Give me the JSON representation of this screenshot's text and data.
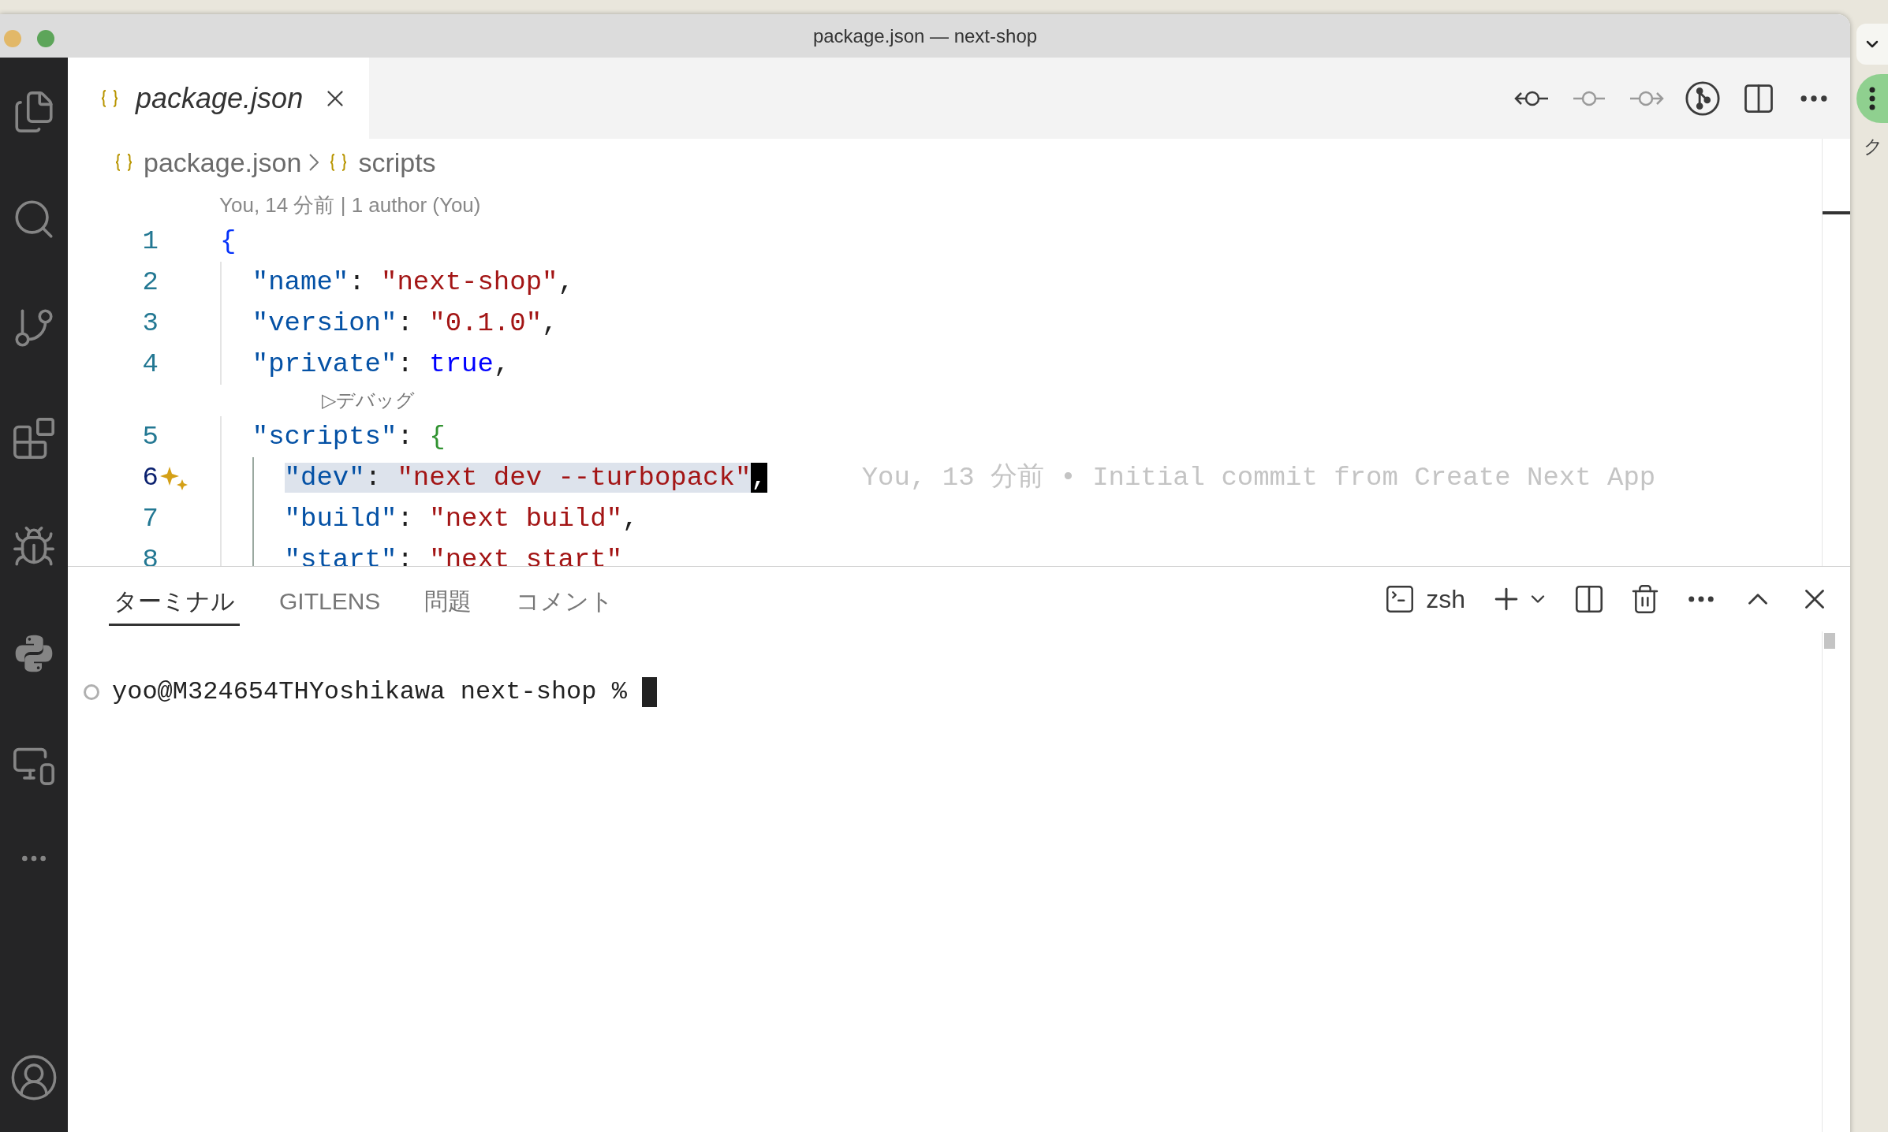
{
  "window": {
    "title": "package.json — next-shop"
  },
  "editor_tabs": [
    {
      "label": "package.json",
      "selected": true,
      "preview": true
    }
  ],
  "breadcrumb": [
    "package.json",
    "scripts"
  ],
  "codelens": "You, 14 分前 | 1 author (You)",
  "lines": [
    {
      "number": "1",
      "current": false,
      "tokens": [
        {
          "kind": "brace1",
          "text": "{"
        }
      ],
      "children": [
        {
          "number": "2",
          "current": false,
          "tokens": [
            {
              "kind": "key",
              "text": "\"name\""
            },
            {
              "kind": "punct",
              "text": ": "
            },
            {
              "kind": "string",
              "text": "\"next-shop\""
            },
            {
              "kind": "punct",
              "text": ","
            }
          ]
        },
        {
          "number": "3",
          "current": false,
          "tokens": [
            {
              "kind": "key",
              "text": "\"version\""
            },
            {
              "kind": "punct",
              "text": ": "
            },
            {
              "kind": "string",
              "text": "\"0.1.0\""
            },
            {
              "kind": "punct",
              "text": ","
            }
          ]
        },
        {
          "number": "4",
          "current": false,
          "tokens": [
            {
              "kind": "key",
              "text": "\"private\""
            },
            {
              "kind": "punct",
              "text": ": "
            },
            {
              "kind": "bool",
              "text": "true"
            },
            {
              "kind": "punct",
              "text": ","
            }
          ]
        },
        {
          "number": "5",
          "current": false,
          "lens": "▷デバッグ",
          "tokens": [
            {
              "kind": "key",
              "text": "\"scripts\""
            },
            {
              "kind": "punct",
              "text": ": "
            },
            {
              "kind": "brace2",
              "text": "{"
            }
          ],
          "children": [
            {
              "number": "6",
              "current": true,
              "blame": "You, 13 分前 • Initial commit from Create Next App",
              "tokens": [
                {
                  "kind": "key",
                  "text": "\"dev\"",
                  "selected": true
                },
                {
                  "kind": "punct",
                  "text": ": ",
                  "selected": true
                },
                {
                  "kind": "string",
                  "text": "\"next dev --turbopack\"",
                  "selected": true
                },
                {
                  "kind": "punct",
                  "text": ",",
                  "cursor": true
                }
              ]
            },
            {
              "number": "7",
              "current": false,
              "tokens": [
                {
                  "kind": "key",
                  "text": "\"build\""
                },
                {
                  "kind": "punct",
                  "text": ": "
                },
                {
                  "kind": "string",
                  "text": "\"next build\""
                },
                {
                  "kind": "punct",
                  "text": ","
                }
              ]
            },
            {
              "number": "8",
              "current": false,
              "tokens": [
                {
                  "kind": "key",
                  "text": "\"start\""
                },
                {
                  "kind": "punct",
                  "text": ": "
                },
                {
                  "kind": "string",
                  "text": "\"next start\""
                }
              ]
            }
          ]
        }
      ]
    }
  ],
  "panel_tabs": [
    {
      "label": "ターミナル",
      "selected": true
    },
    {
      "label": "GITLENS",
      "selected": false
    },
    {
      "label": "問題",
      "selected": false
    },
    {
      "label": "コメント",
      "selected": false
    }
  ],
  "terminal_profile": "zsh",
  "terminal": {
    "prompt": "yoo@M324654THYoshikawa next-shop % "
  },
  "behind_window": {
    "text": "ク"
  }
}
